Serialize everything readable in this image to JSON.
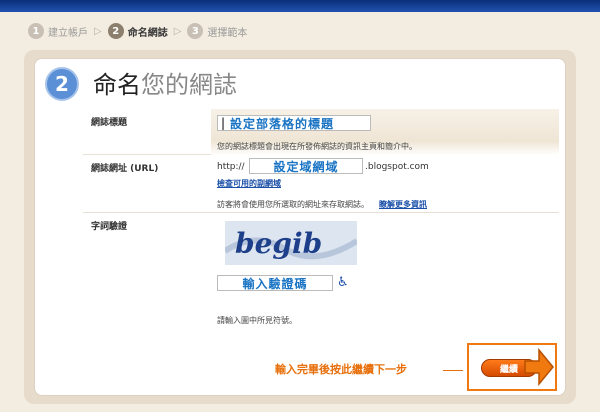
{
  "steps": [
    {
      "number": "1",
      "label": "建立帳戶"
    },
    {
      "number": "2",
      "label": "命名網誌"
    },
    {
      "number": "3",
      "label": "選擇範本"
    }
  ],
  "header": {
    "number": "2",
    "title_dark": "命名",
    "title_light": "您的網誌"
  },
  "form": {
    "blog_title": {
      "label": "網誌標題",
      "annotation": "設定部落格的標題",
      "hint": "您的網誌標題會出現在所發佈網誌的資訊主頁和簡介中。"
    },
    "blog_address": {
      "label": "網誌網址 (URL)",
      "prefix": "http://",
      "annotation": "設定域網域",
      "suffix": ".blogspot.com",
      "check_link": "檢查可用的副網域",
      "hint": "訪客將會使用您所選取的網址來存取網誌。",
      "learn_more": "瞭解更多資訊"
    },
    "word_verification": {
      "label": "字詞驗證",
      "captcha_text": "begib",
      "annotation": "輸入驗證碼",
      "hint": "請輸入圖中所見符號。"
    }
  },
  "bottom": {
    "annotation": "輸入完畢後按此繼續下一步",
    "continue_label": "繼續"
  },
  "colors": {
    "accent_orange": "#f07a10",
    "step_blue": "#5b8fd6",
    "link_blue": "#1a4fa8"
  }
}
